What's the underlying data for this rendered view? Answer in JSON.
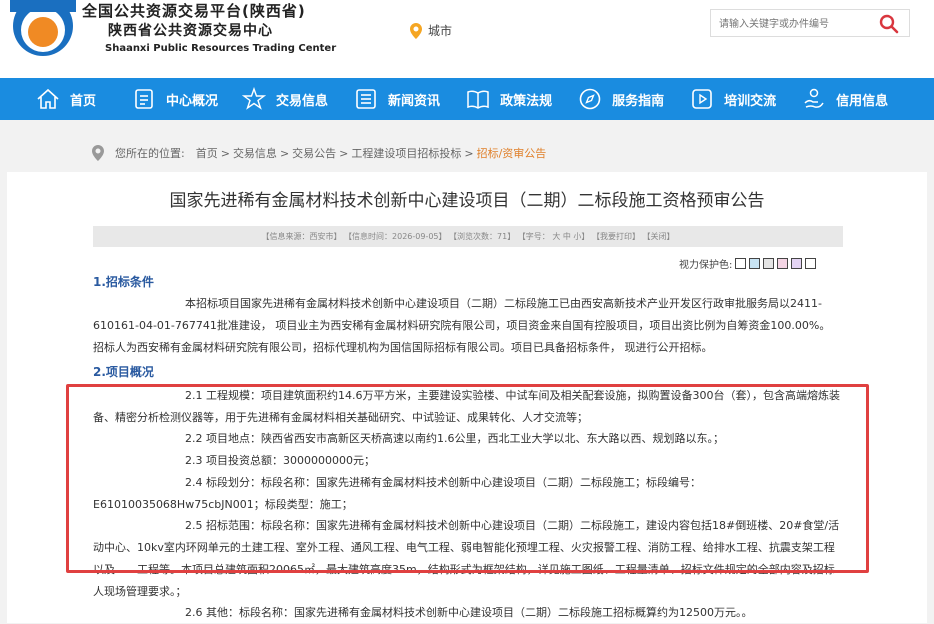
{
  "header": {
    "logo_cn_1": "全国公共资源交易平台(陕西省)",
    "logo_cn_2": "陕西省公共资源交易中心",
    "logo_en": "Shaanxi Public Resources Trading Center",
    "city_label": "城市",
    "search_placeholder": "请输入关键字或办件编号"
  },
  "nav": {
    "items": [
      {
        "label": "首页",
        "icon": "home-icon"
      },
      {
        "label": "中心概况",
        "icon": "document-icon"
      },
      {
        "label": "交易信息",
        "icon": "star-icon"
      },
      {
        "label": "新闻资讯",
        "icon": "list-icon"
      },
      {
        "label": "政策法规",
        "icon": "book-icon"
      },
      {
        "label": "服务指南",
        "icon": "compass-icon"
      },
      {
        "label": "培训交流",
        "icon": "play-icon"
      },
      {
        "label": "信用信息",
        "icon": "hand-icon"
      }
    ]
  },
  "breadcrumb": {
    "prefix": "您所在的位置:",
    "items": [
      "首页",
      "交易信息",
      "交易公告",
      "工程建设项目招标投标"
    ],
    "current": "招标/资审公告"
  },
  "article": {
    "title": "国家先进稀有金属材料技术创新中心建设项目（二期）二标段施工资格预审公告",
    "info": "【信息来源：西安市】 【信息时间：2026-09-05】 【浏览次数：71】 【字号： 大 中 小】 【我要打印】 【关闭】",
    "protect_label": "视力保护色:",
    "section1": "1.招标条件",
    "p1": "本招标项目国家先进稀有金属材料技术创新中心建设项目（二期）二标段施工已由西安高新技术产业开发区行政审批服务局以2411-610161-04-01-767741批准建设， 项目业主为西安稀有金属材料研究院有限公司，项目资金来自国有控股项目，项目出资比例为自筹资金100.00%。招标人为西安稀有金属材料研究院有限公司，招标代理机构为国信国际招标有限公司。项目已具备招标条件， 现进行公开招标。",
    "section2": "2.项目概况",
    "p21": "2.1 工程规模：项目建筑面积约14.6万平方米，主要建设实验楼、中试车间及相关配套设施，拟购置设备300台（套），包含高端熔炼装备、精密分析检测仪器等，用于先进稀有金属材料相关基础研究、中试验证、成果转化、人才交流等；",
    "p22": "2.2 项目地点：陕西省西安市高新区天桥高速以南约1.6公里，西北工业大学以北、东大路以西、规划路以东。；",
    "p23": "2.3 项目投资总额：3000000000元；",
    "p24": "2.4 标段划分：标段名称：国家先进稀有金属材料技术创新中心建设项目（二期）二标段施工；标段编号：E61010035068Hw75cbJN001；标段类型：施工；",
    "p25": "2.5 招标范围：标段名称：国家先进稀有金属材料技术创新中心建设项目（二期）二标段施工，建设内容包括18#倒班楼、20#食堂/活动中心、10kv室内环网单元的土建工程、室外工程、通风工程、电气工程、弱电智能化预埋工程、火灾报警工程、消防工程、给排水工程、抗震支架工程以及……工程等。本项目总建筑面积20065㎡，最大建筑高度35m，结构形式为框架结构，详见施工图纸、工程量清单、招标文件规定的全部内容及招标人现场管理要求。；",
    "p26": "2.6 其他：标段名称：国家先进稀有金属材料技术创新中心建设项目（二期）二标段施工招标概算约为12500万元。。"
  },
  "colors": {
    "nav_bg": "#1a8ce0",
    "section_color": "#2a5aa0",
    "breadcrumb_current": "#e0802a",
    "highlight_border": "#e04040",
    "logo_orange": "#f08a24",
    "logo_blue": "#1a6fc0"
  }
}
